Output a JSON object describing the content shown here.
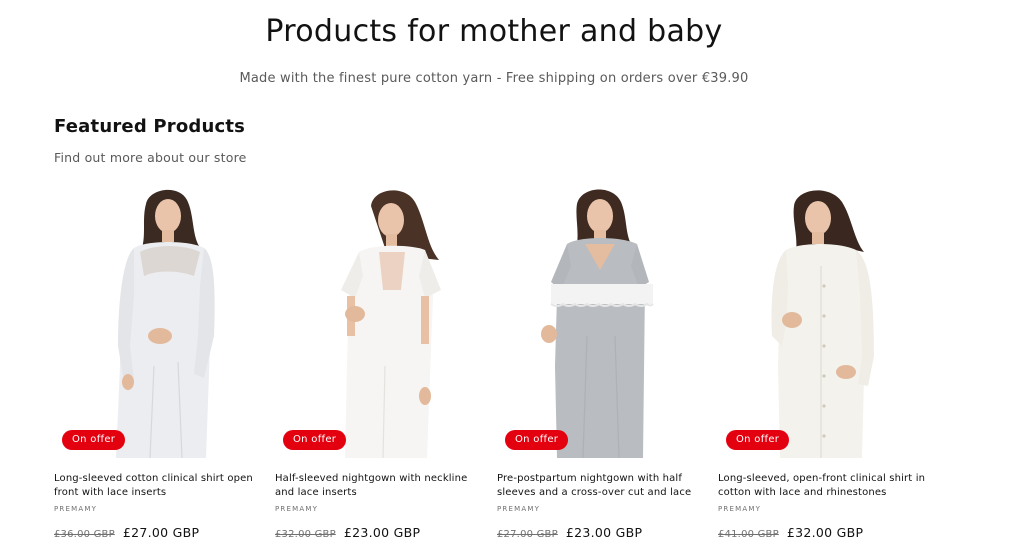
{
  "hero": {
    "title": "Products for mother and baby",
    "subtitle": "Made with the finest pure cotton yarn - Free shipping on orders over €39.90"
  },
  "section": {
    "title": "Featured Products",
    "description": "Find out more about our store"
  },
  "colors": {
    "badge": "#e3000f",
    "text": "#121212",
    "muted": "#707070"
  },
  "products": [
    {
      "title": "Long-sleeved cotton clinical shirt open front with lace inserts",
      "vendor": "PREMAMY",
      "badge": "On offer",
      "old_price": "£36.00 GBP",
      "price": "£27.00 GBP",
      "image": "white long-sleeved maternity nightgown with lace yoke"
    },
    {
      "title": "Half-sleeved nightgown with neckline and lace inserts",
      "vendor": "PREMAMY",
      "badge": "On offer",
      "old_price": "£32.00 GBP",
      "price": "£23.00 GBP",
      "image": "white short-sleeved maternity nightgown with lace neckline"
    },
    {
      "title": "Pre-postpartum nightgown with half sleeves and a cross-over cut and lace",
      "vendor": "PREMAMY",
      "badge": "On offer",
      "old_price": "£27.00 GBP",
      "price": "£23.00 GBP",
      "image": "grey cross-over maternity nightgown with white lace band"
    },
    {
      "title": "Long-sleeved, open-front clinical shirt in cotton with lace and rhinestones",
      "vendor": "PREMAMY",
      "badge": "On offer",
      "old_price": "£41.00 GBP",
      "price": "£32.00 GBP",
      "image": "cream long-sleeved button-front maternity shirt"
    }
  ]
}
